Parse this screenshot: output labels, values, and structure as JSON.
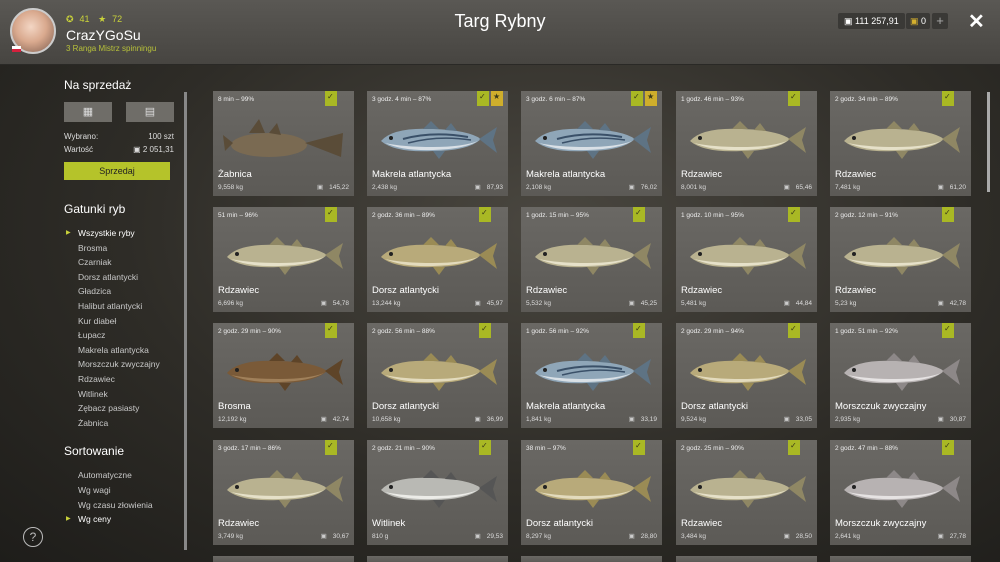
{
  "header": {
    "title": "Targ Rybny",
    "user": {
      "name": "CrazYGoSu",
      "level": "41",
      "stars": "72",
      "rank": "3 Ranga Mistrz spinningu"
    },
    "money": "111 257,91",
    "gold": "0",
    "plus": "+",
    "close": "✕"
  },
  "sidebar": {
    "sale_title": "Na sprzedaż",
    "view_grid": "▦",
    "view_list": "▤",
    "selected_label": "Wybrano:",
    "selected_value": "100 szt",
    "value_label": "Wartość",
    "value_value": "2 051,31",
    "sell_button": "Sprzedaj",
    "species_title": "Gatunki ryb",
    "species": [
      "Wszystkie ryby",
      "Brosma",
      "Czarniak",
      "Dorsz atlantycki",
      "Gładzica",
      "Halibut atlantycki",
      "Kur diabeł",
      "Łupacz",
      "Makrela atlantycka",
      "Morszczuk zwyczajny",
      "Rdzawiec",
      "Witlinek",
      "Zębacz pasiasty",
      "Żabnica"
    ],
    "sort_title": "Sortowanie",
    "sorts": [
      "Automatyczne",
      "Wg wagi",
      "Wg czasu złowienia",
      "Wg ceny"
    ]
  },
  "help": "?",
  "cards": [
    {
      "time": "8 min – 99%",
      "name": "Żabnica",
      "weight": "9,558 kg",
      "price": "145,22",
      "fish": "monk",
      "star": false
    },
    {
      "time": "3 godz. 4 min – 87%",
      "name": "Makrela atlantycka",
      "weight": "2,438 kg",
      "price": "87,93",
      "fish": "mackerel",
      "star": true
    },
    {
      "time": "3 godz. 6 min – 87%",
      "name": "Makrela atlantycka",
      "weight": "2,108 kg",
      "price": "76,02",
      "fish": "mackerel",
      "star": true
    },
    {
      "time": "1 godz. 46 min – 93%",
      "name": "Rdzawiec",
      "weight": "8,001 kg",
      "price": "65,46",
      "fish": "pollock",
      "star": false
    },
    {
      "time": "2 godz. 34 min – 89%",
      "name": "Rdzawiec",
      "weight": "7,481 kg",
      "price": "61,20",
      "fish": "pollock",
      "star": false
    },
    {
      "time": "51 min – 96%",
      "name": "Rdzawiec",
      "weight": "6,696 kg",
      "price": "54,78",
      "fish": "pollock",
      "star": false
    },
    {
      "time": "2 godz. 36 min – 89%",
      "name": "Dorsz atlantycki",
      "weight": "13,244 kg",
      "price": "45,97",
      "fish": "cod",
      "star": false
    },
    {
      "time": "1 godz. 15 min – 95%",
      "name": "Rdzawiec",
      "weight": "5,532 kg",
      "price": "45,25",
      "fish": "pollock",
      "star": false
    },
    {
      "time": "1 godz. 10 min – 95%",
      "name": "Rdzawiec",
      "weight": "5,481 kg",
      "price": "44,84",
      "fish": "pollock",
      "star": false
    },
    {
      "time": "2 godz. 12 min – 91%",
      "name": "Rdzawiec",
      "weight": "5,23 kg",
      "price": "42,78",
      "fish": "pollock",
      "star": false
    },
    {
      "time": "2 godz. 29 min – 90%",
      "name": "Brosma",
      "weight": "12,192 kg",
      "price": "42,74",
      "fish": "cusk",
      "star": false
    },
    {
      "time": "2 godz. 56 min – 88%",
      "name": "Dorsz atlantycki",
      "weight": "10,658 kg",
      "price": "36,99",
      "fish": "cod",
      "star": false
    },
    {
      "time": "1 godz. 56 min – 92%",
      "name": "Makrela atlantycka",
      "weight": "1,841 kg",
      "price": "33,19",
      "fish": "mackerel",
      "star": false
    },
    {
      "time": "2 godz. 29 min – 94%",
      "name": "Dorsz atlantycki",
      "weight": "9,524 kg",
      "price": "33,05",
      "fish": "cod",
      "star": false
    },
    {
      "time": "1 godz. 51 min – 92%",
      "name": "Morszczuk zwyczajny",
      "weight": "2,935 kg",
      "price": "30,87",
      "fish": "hake",
      "star": false
    },
    {
      "time": "3 godz. 17 min – 86%",
      "name": "Rdzawiec",
      "weight": "3,749 kg",
      "price": "30,67",
      "fish": "pollock",
      "star": false
    },
    {
      "time": "2 godz. 21 min – 90%",
      "name": "Witlinek",
      "weight": "810 g",
      "price": "29,53",
      "fish": "whiting",
      "star": false
    },
    {
      "time": "38 min – 97%",
      "name": "Dorsz atlantycki",
      "weight": "8,297 kg",
      "price": "28,80",
      "fish": "cod",
      "star": false
    },
    {
      "time": "2 godz. 25 min – 90%",
      "name": "Rdzawiec",
      "weight": "3,484 kg",
      "price": "28,50",
      "fish": "pollock",
      "star": false
    },
    {
      "time": "2 godz. 47 min – 88%",
      "name": "Morszczuk zwyczajny",
      "weight": "2,641 kg",
      "price": "27,78",
      "fish": "hake",
      "star": false
    }
  ]
}
